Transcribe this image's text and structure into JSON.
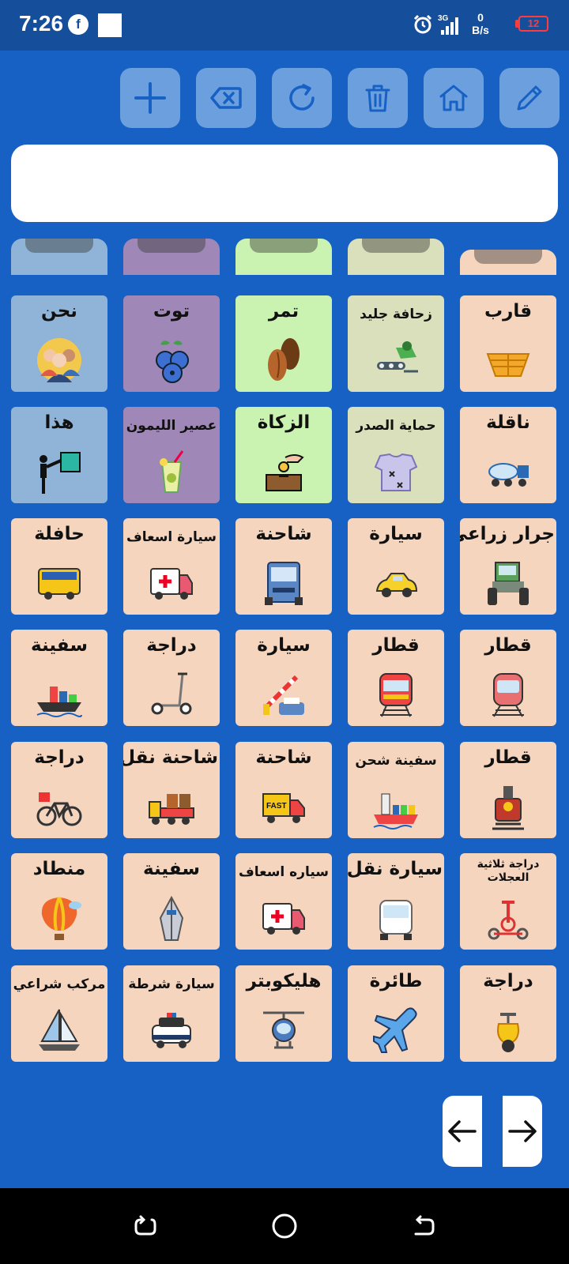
{
  "status": {
    "time": "7:26",
    "network": "3G",
    "speed_value": "0",
    "speed_unit": "B/s",
    "battery": "12"
  },
  "toolbar": {
    "buttons": [
      {
        "name": "add-button",
        "icon": "plus-icon"
      },
      {
        "name": "backspace-button",
        "icon": "backspace-icon"
      },
      {
        "name": "refresh-button",
        "icon": "refresh-icon"
      },
      {
        "name": "trash-button",
        "icon": "trash-icon"
      },
      {
        "name": "home-button",
        "icon": "home-icon"
      },
      {
        "name": "edit-button",
        "icon": "pencil-icon"
      }
    ]
  },
  "sentence": {
    "text": ""
  },
  "folder_tabs": [
    {
      "color": "#8fb4d8"
    },
    {
      "color": "#9f88b7"
    },
    {
      "color": "#caf2b0"
    },
    {
      "color": "#d9e0bb"
    },
    {
      "color": "#f5d5be"
    }
  ],
  "grid": {
    "rows": [
      [
        {
          "label": "نحن",
          "bg": "#8fb4d8",
          "icon": "people-icon"
        },
        {
          "label": "توت",
          "bg": "#9f88b7",
          "icon": "blueberry-icon"
        },
        {
          "label": "تمر",
          "bg": "#caf2b0",
          "icon": "dates-icon"
        },
        {
          "label": "زحافة جليد",
          "bg": "#d9e0bb",
          "icon": "snowmobile-icon",
          "size": "small"
        },
        {
          "label": "قارب",
          "bg": "#f5d5be",
          "icon": "boat-icon"
        }
      ],
      [
        {
          "label": "هذا",
          "bg": "#8fb4d8",
          "icon": "pointing-person-icon"
        },
        {
          "label": "عصير الليمون",
          "bg": "#9f88b7",
          "icon": "lemonade-icon",
          "size": "small"
        },
        {
          "label": "الزكاة",
          "bg": "#caf2b0",
          "icon": "donation-box-icon"
        },
        {
          "label": "حماية الصدر",
          "bg": "#d9e0bb",
          "icon": "chest-guard-icon",
          "size": "small"
        },
        {
          "label": "ناقلة",
          "bg": "#f5d5be",
          "icon": "tanker-truck-icon"
        }
      ],
      [
        {
          "label": "حافلة",
          "bg": "#f5d5be",
          "icon": "bus-icon"
        },
        {
          "label": "سيارة اسعاف",
          "bg": "#f5d5be",
          "icon": "ambulance-icon",
          "size": "small"
        },
        {
          "label": "شاحنة",
          "bg": "#f5d5be",
          "icon": "truck-front-icon"
        },
        {
          "label": "سيارة",
          "bg": "#f5d5be",
          "icon": "taxi-icon"
        },
        {
          "label": "جرار زراعى",
          "bg": "#f5d5be",
          "icon": "tractor-icon"
        }
      ],
      [
        {
          "label": "سفينة",
          "bg": "#f5d5be",
          "icon": "cargo-ship-icon"
        },
        {
          "label": "دراجة",
          "bg": "#f5d5be",
          "icon": "scooter-icon"
        },
        {
          "label": "سيارة",
          "bg": "#f5d5be",
          "icon": "car-barrier-icon"
        },
        {
          "label": "قطار",
          "bg": "#f5d5be",
          "icon": "train-icon"
        },
        {
          "label": "قطار",
          "bg": "#f5d5be",
          "icon": "metro-train-icon"
        }
      ],
      [
        {
          "label": "دراجة",
          "bg": "#f5d5be",
          "icon": "bicycle-icon"
        },
        {
          "label": "شاحنة نقل",
          "bg": "#f5d5be",
          "icon": "cargo-truck-icon"
        },
        {
          "label": "شاحنة",
          "bg": "#f5d5be",
          "icon": "delivery-truck-icon"
        },
        {
          "label": "سفينة شحن",
          "bg": "#f5d5be",
          "icon": "container-ship-icon",
          "size": "small"
        },
        {
          "label": "قطار",
          "bg": "#f5d5be",
          "icon": "steam-train-icon"
        }
      ],
      [
        {
          "label": "منطاد",
          "bg": "#f5d5be",
          "icon": "hot-air-balloon-icon"
        },
        {
          "label": "سفينة",
          "bg": "#f5d5be",
          "icon": "ship-front-icon"
        },
        {
          "label": "سياره اسعاف",
          "bg": "#f5d5be",
          "icon": "ambulance-icon",
          "size": "small"
        },
        {
          "label": "سيارة نقل",
          "bg": "#f5d5be",
          "icon": "van-icon"
        },
        {
          "label": "دراجة ثلاثية العجلات",
          "bg": "#f5d5be",
          "icon": "tricycle-icon",
          "size": "tiny"
        }
      ],
      [
        {
          "label": "مركب شراعي",
          "bg": "#f5d5be",
          "icon": "sailboat-icon",
          "size": "small"
        },
        {
          "label": "سيارة شرطة",
          "bg": "#f5d5be",
          "icon": "police-car-icon",
          "size": "small"
        },
        {
          "label": "هليكوبتر",
          "bg": "#f5d5be",
          "icon": "helicopter-icon"
        },
        {
          "label": "طائرة",
          "bg": "#f5d5be",
          "icon": "airplane-icon"
        },
        {
          "label": "دراجة",
          "bg": "#f5d5be",
          "icon": "motor-scooter-icon"
        }
      ]
    ]
  },
  "nav": {
    "prev_icon": "arrow-left-icon",
    "next_icon": "arrow-right-icon"
  },
  "colors": {
    "background": "#1761c4",
    "status_bar": "#154f9c",
    "toolbar_button": "#6c9fde"
  }
}
